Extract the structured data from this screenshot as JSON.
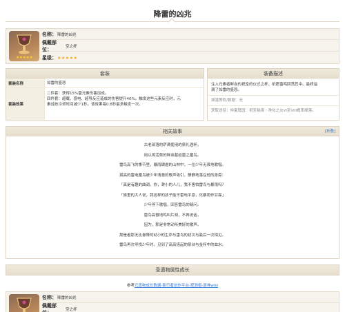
{
  "page": {
    "title": "降雷的凶兆"
  },
  "info": {
    "name_label": "名称：",
    "name_value": "降雷的凶兆",
    "slot_label": "佩戴部位：",
    "slot_value": "空之杯",
    "rarity_label": "星级：",
    "rarity_stars": "★★★★★",
    "thumb_stars": "★★★★★"
  },
  "set_panel": {
    "header": "套装",
    "rows": [
      {
        "key": "套装名称",
        "value": "如雷的盛怒"
      },
      {
        "key": "套装效果",
        "lines": [
          "二件套：获得15%雷元素伤害加成。",
          "四件套：超载、感电、超导反应造成的伤害提升40%。触发这些元素反应时，元",
          "素战技冷却时间减少1秒。该效果每0.8秒最多触发一次。"
        ]
      }
    ]
  },
  "desc_panel": {
    "header": "装备描述",
    "lines": [
      "注入元素者鲜血的祝圣的仪式之杯，祈愿雷鸣回荡其中。最终溢",
      "满了如雷的盛怒。"
    ],
    "source1": "掉落等阶/数据：无",
    "source2": "获取途径：仲夏庭园：祝圣秘境・净化之炎VI至VIII概率掉落。"
  },
  "story_panel": {
    "header": "相关故事",
    "toggle": "[折叠]",
    "lines": [
      "古老部落的萨满使用的祭礼酒杯，",
      "用以将活祭的鲜血献给雷之魔鸟。",
      "雷鸟高飞的季节里，暴雨肆虐的山林中，一位少年无畏地歌唱。",
      "孤高的雷电魔鸟被少年清澈的歌声吸引，静静地落在他的身旁：",
      "「真是有趣的曲调。你，渺小的人儿，我不害怕雷鸟与暴雨吗？",
      "「族里的大人说，我这样的孩子能令雷电平息，化暴雨作甘霖」",
      "少年停下歌唱，回答雷鸟的疑问。",
      "雷鸟高傲地鸣叫片刻，不再说话，",
      "因为，那是非常动听美好的歌声。",
      "那是者那无比悬殊的幼小的生命与雷鸟的初次与最后一次相见。",
      "雷鸟再次寻找少年时，见到了高高搭起的祭台与金杯中的血水。"
    ]
  },
  "growth_panel": {
    "header": "圣遗物属性成长"
  },
  "ref": {
    "prefix": "参考",
    "link": "元遗物成长数据-新行者创作平台-观测枢-原神wiki"
  },
  "info2": {
    "name_label": "名称：",
    "name_value": "降雷的凶兆",
    "slot_label": "佩戴部位：",
    "slot_value": "空之杯"
  },
  "colors": {
    "accent_link": "#3a7bd5",
    "panel_header": "#e6dfcf",
    "star": "#f5a623"
  }
}
